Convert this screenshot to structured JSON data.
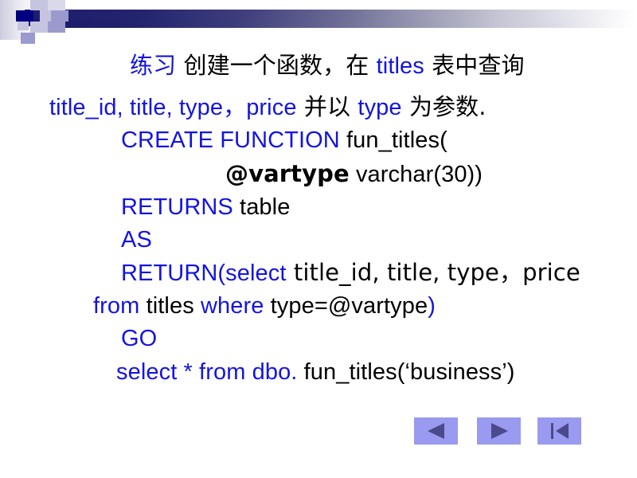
{
  "slide": {
    "title_prefix": "练习",
    "header": {
      "decoration_name": "gradient-bar-decoration",
      "gradient_start_color": "#1d1d70",
      "gradient_end_color": "#ffffff",
      "accent_square_color": "#000080"
    },
    "keyword_color": "#1414e0",
    "body_color": "#000000",
    "lines": [
      {
        "id": "line-1",
        "segments": [
          {
            "text": "练习",
            "style": "kw"
          },
          {
            "text": "   创建一个函数，在 ",
            "style": "bk"
          },
          {
            "text": "titles",
            "style": "kw"
          },
          {
            "text": " 表中查询",
            "style": "bk"
          }
        ]
      },
      {
        "id": "line-2",
        "segments": [
          {
            "text": "title_id, title, type，price",
            "style": "kw"
          },
          {
            "text": " 并以 ",
            "style": "bk"
          },
          {
            "text": "type",
            "style": "kw"
          },
          {
            "text": " 为参数.",
            "style": "bk"
          }
        ]
      },
      {
        "id": "line-3",
        "segments": [
          {
            "text": "CREATE  FUNCTION",
            "style": "kw"
          },
          {
            "text": "  fun_titles(",
            "style": "bk"
          }
        ]
      },
      {
        "id": "line-4",
        "segments": [
          {
            "text": "@vartype",
            "style": "bold-var"
          },
          {
            "text": "  varchar(30))",
            "style": "bk"
          }
        ]
      },
      {
        "id": "line-5",
        "segments": [
          {
            "text": "RETURNS",
            "style": "kw"
          },
          {
            "text": "  table",
            "style": "bk"
          }
        ]
      },
      {
        "id": "line-6",
        "segments": [
          {
            "text": "AS",
            "style": "kw"
          }
        ]
      },
      {
        "id": "line-7",
        "segments": [
          {
            "text": "RETURN(select",
            "style": "kw"
          },
          {
            "text": "  title_id, title, type，price",
            "style": "bk"
          }
        ]
      },
      {
        "id": "line-8",
        "segments": [
          {
            "text": "from",
            "style": "kw"
          },
          {
            "text": "  titles  ",
            "style": "bk"
          },
          {
            "text": "where",
            "style": "kw"
          },
          {
            "text": "  type=@vartype",
            "style": "bk"
          },
          {
            "text": ")",
            "style": "kw"
          }
        ]
      },
      {
        "id": "line-9",
        "segments": [
          {
            "text": "GO",
            "style": "kw"
          }
        ]
      },
      {
        "id": "line-10",
        "segments": [
          {
            "text": "select   *  from   dbo.",
            "style": "kw"
          },
          {
            "text": " fun_titles(‘business’)",
            "style": "bk"
          }
        ]
      }
    ]
  },
  "nav": {
    "button_bg": "#9a9af0",
    "glyph_color": "#4a4a8c",
    "buttons": [
      {
        "name": "previous-slide-button",
        "icon": "triangle-left-icon",
        "label": "Previous"
      },
      {
        "name": "next-slide-button",
        "icon": "triangle-right-icon",
        "label": "Next"
      },
      {
        "name": "first-slide-button",
        "icon": "skip-to-start-icon",
        "label": "First"
      }
    ]
  }
}
